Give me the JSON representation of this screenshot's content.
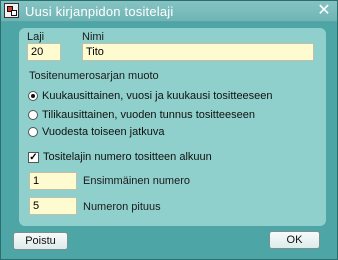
{
  "window": {
    "title": "Uusi kirjanpidon tositelaji",
    "close_glyph": "✕"
  },
  "fields": {
    "laji_label": "Laji",
    "laji_value": "20",
    "nimi_label": "Nimi",
    "nimi_value": "Tito"
  },
  "numbering": {
    "section_label": "Tositenumerosarjan muoto",
    "options": [
      {
        "label": "Kuukausittainen, vuosi ja kuukausi tositteeseen",
        "selected": true
      },
      {
        "label": "Tilikausittainen, vuoden tunnus tositteeseen",
        "selected": false
      },
      {
        "label": "Vuodesta toiseen jatkuva",
        "selected": false
      }
    ]
  },
  "prefix_option": {
    "label": "Tositelajin numero tositteen alkuun",
    "checked": true
  },
  "first_number": {
    "value": "1",
    "label": "Ensimmäinen numero"
  },
  "length": {
    "value": "5",
    "label": "Numeron pituus"
  },
  "buttons": {
    "exit": "Poistu",
    "ok": "OK"
  },
  "colors": {
    "background": "#4ea5a5",
    "panel": "#8fd0cc",
    "field": "#fffbd0"
  }
}
